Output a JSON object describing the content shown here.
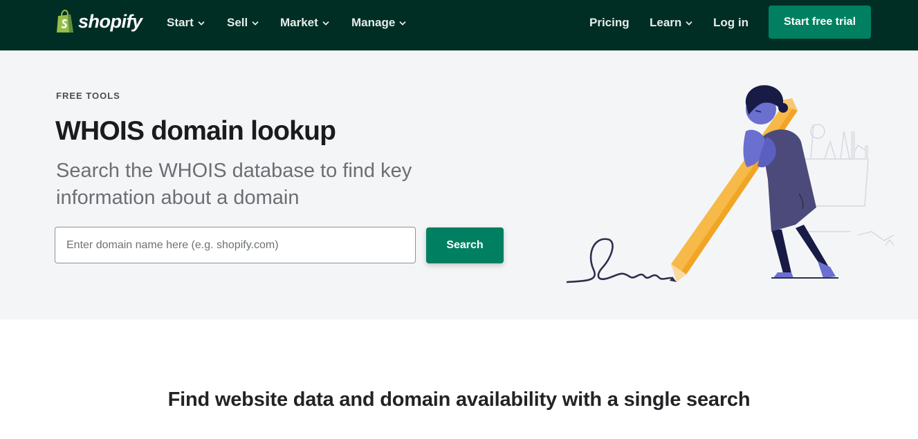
{
  "nav": {
    "logo": {
      "text": "shopify",
      "icon": "shopping-bag-logo-icon"
    },
    "menus": [
      {
        "label": "Start",
        "dropdown": true
      },
      {
        "label": "Sell",
        "dropdown": true
      },
      {
        "label": "Market",
        "dropdown": true
      },
      {
        "label": "Manage",
        "dropdown": true
      }
    ],
    "right": [
      {
        "label": "Pricing",
        "dropdown": false
      },
      {
        "label": "Learn",
        "dropdown": true
      },
      {
        "label": "Log in",
        "dropdown": false
      }
    ],
    "cta_label": "Start free trial"
  },
  "hero": {
    "eyebrow": "FREE TOOLS",
    "title": "WHOIS domain lookup",
    "subtitle": "Search the WHOIS database to find key information about a domain",
    "search": {
      "placeholder": "Enter domain name here (e.g. shopify.com)",
      "value": "",
      "button_label": "Search"
    },
    "illustration": "person-with-giant-pencil-drawing-illustration"
  },
  "section": {
    "title": "Find website data and domain availability with a single search"
  },
  "colors": {
    "nav_bg": "#002e25",
    "accent_green": "#008060",
    "hero_bg": "#f4f5f7",
    "logo_green": "#95bf47"
  }
}
